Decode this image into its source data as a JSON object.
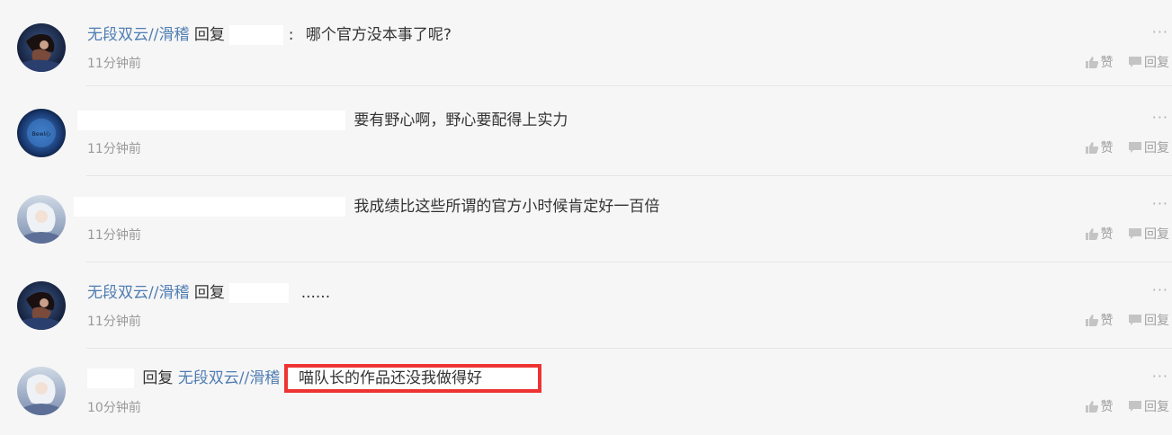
{
  "comments": [
    {
      "username": "无段双云//滑稽",
      "reply_word": "回复",
      "separator": ":",
      "content": "哪个官方没本事了呢?",
      "time": "11分钟前"
    },
    {
      "content": "要有野心啊，野心要配得上实力",
      "time": "11分钟前",
      "avatar_text": "Bewl心"
    },
    {
      "content": "我成绩比这些所谓的官方小时候肯定好一百倍",
      "time": "11分钟前"
    },
    {
      "username": "无段双云//滑稽",
      "reply_word": "回复",
      "content": "......",
      "time": "11分钟前"
    },
    {
      "reply_word": "回复",
      "reply_target": "无段双云//滑稽",
      "content": "喵队长的作品还没我做得好",
      "time": "10分钟前"
    }
  ],
  "actions": {
    "like_label": "赞",
    "reply_label": "回复",
    "more_label": "···"
  },
  "colors": {
    "username": "#4f7db3",
    "highlight": "#ee3333",
    "meta": "#999999"
  },
  "icons": [
    "thumbs-up-icon",
    "comment-icon",
    "more-icon"
  ]
}
